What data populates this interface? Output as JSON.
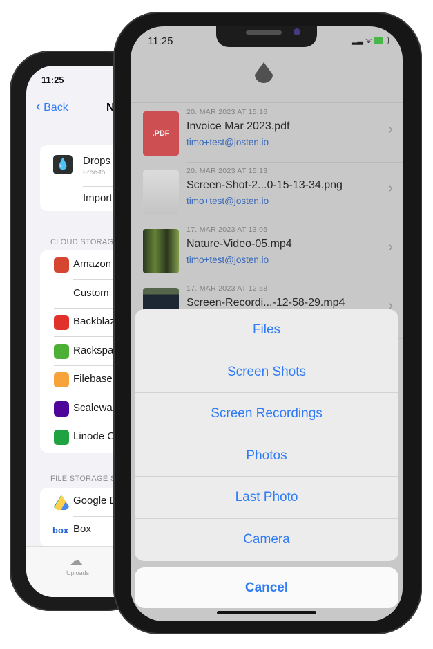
{
  "left": {
    "status_time": "11:25",
    "back_label": "Back",
    "title_partial": "N",
    "app_card": {
      "name": "Drops",
      "subtitle": "Free-to",
      "import_label": "Import"
    },
    "cloud_header": "CLOUD STORAG",
    "cloud_items": [
      {
        "label": "Amazon",
        "icon": "amazon-s3-icon",
        "color": "#d6452f"
      },
      {
        "label": "Custom",
        "icon": "",
        "color": ""
      },
      {
        "label": "Backblaze",
        "icon": "backblaze-icon",
        "color": "#e0312a"
      },
      {
        "label": "Rackspace",
        "icon": "rackspace-cloud-icon",
        "color": "#4caf36"
      },
      {
        "label": "Filebase",
        "icon": "filebase-icon",
        "color": "#f7a23a"
      },
      {
        "label": "Scaleway",
        "icon": "scaleway-icon",
        "color": "#4f0599"
      },
      {
        "label": "Linode C",
        "icon": "linode-icon",
        "color": "#1fa340"
      }
    ],
    "file_header": "FILE STORAGE S",
    "file_items": [
      {
        "label": "Google D",
        "icon": "google-drive-icon"
      },
      {
        "label": "Box",
        "icon": "box-logo-icon",
        "logo_text": "box"
      }
    ],
    "tab_uploads": "Uploads"
  },
  "right": {
    "status_time": "11:25",
    "logo": "drop-icon",
    "files": [
      {
        "date": "20. MAR 2023 AT 15:16",
        "name": "Invoice Mar 2023.pdf",
        "account": "timo+test@josten.io",
        "thumb": "pdf",
        "thumb_label": ".PDF"
      },
      {
        "date": "20. MAR 2023 AT 15:13",
        "name": "Screen-Shot-2...0-15-13-34.png",
        "account": "timo+test@josten.io",
        "thumb": "screenshot"
      },
      {
        "date": "17. MAR 2023 AT 13:05",
        "name": "Nature-Video-05.mp4",
        "account": "timo+test@josten.io",
        "thumb": "forest"
      },
      {
        "date": "17. MAR 2023 AT 12:58",
        "name": "Screen-Recordi...-12-58-29.mp4",
        "account": "",
        "thumb": "recording"
      }
    ],
    "action_sheet": [
      "Files",
      "Screen Shots",
      "Screen Recordings",
      "Photos",
      "Last Photo",
      "Camera"
    ],
    "cancel_label": "Cancel",
    "accent": "#2f7cf6"
  }
}
